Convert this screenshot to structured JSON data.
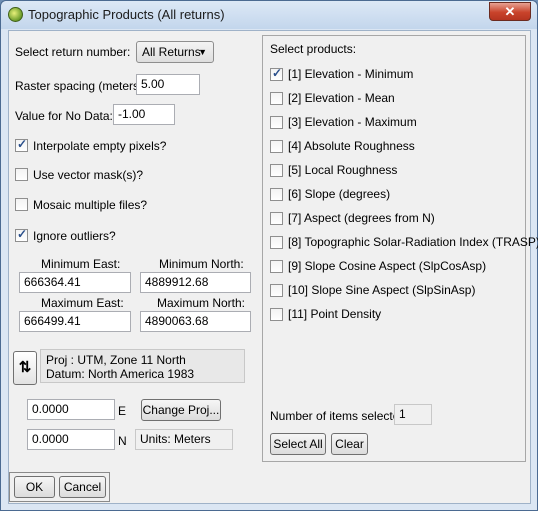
{
  "window": {
    "title": "Topographic Products (All returns)",
    "close_glyph": "✕"
  },
  "left": {
    "select_return_label": "Select return number:",
    "return_value": "All Returns",
    "raster_spacing_label": "Raster spacing (meters):",
    "raster_spacing_value": "5.00",
    "nodata_label": "Value for No Data:",
    "nodata_value": "-1.00",
    "interpolate": {
      "label": "Interpolate empty pixels?",
      "checked": true
    },
    "vector_mask": {
      "label": "Use vector mask(s)?",
      "checked": false
    },
    "mosaic": {
      "label": "Mosaic multiple files?",
      "checked": false
    },
    "ignore_outliers": {
      "label": "Ignore outliers?",
      "checked": true
    },
    "min_east_label": "Minimum East:",
    "min_east_value": "666364.41",
    "min_north_label": "Minimum North:",
    "min_north_value": "4889912.68",
    "max_east_label": "Maximum East:",
    "max_east_value": "666499.41",
    "max_north_label": "Maximum North:",
    "max_north_value": "4890063.68",
    "swap_glyph": "⇅",
    "proj_line": "Proj : UTM, Zone 11 North",
    "datum_line": "Datum: North America 1983",
    "e_value": "0.0000",
    "e_label": "E",
    "change_proj_label": "Change Proj...",
    "n_value": "0.0000",
    "n_label": "N",
    "units_text": "Units: Meters"
  },
  "right": {
    "select_products_label": "Select products:",
    "products": [
      {
        "label": "[1] Elevation - Minimum",
        "checked": true
      },
      {
        "label": "[2] Elevation - Mean",
        "checked": false
      },
      {
        "label": "[3] Elevation - Maximum",
        "checked": false
      },
      {
        "label": "[4] Absolute Roughness",
        "checked": false
      },
      {
        "label": "[5] Local Roughness",
        "checked": false
      },
      {
        "label": "[6] Slope (degrees)",
        "checked": false
      },
      {
        "label": "[7] Aspect (degrees from N)",
        "checked": false
      },
      {
        "label": "[8] Topographic Solar-Radiation Index (TRASP)",
        "checked": false
      },
      {
        "label": "[9] Slope Cosine Aspect (SlpCosAsp)",
        "checked": false
      },
      {
        "label": "[10] Slope Sine Aspect (SlpSinAsp)",
        "checked": false
      },
      {
        "label": "[11] Point Density",
        "checked": false
      }
    ],
    "items_selected_label": "Number of items selected:",
    "items_selected_value": "1",
    "select_all_label": "Select All",
    "clear_label": "Clear"
  },
  "footer": {
    "ok_label": "OK",
    "cancel_label": "Cancel"
  },
  "colors": {
    "titlebar": "#c3d6ec",
    "close": "#c9432b",
    "check": "#2a4f8b",
    "window_bg": "#f0f0f0"
  }
}
